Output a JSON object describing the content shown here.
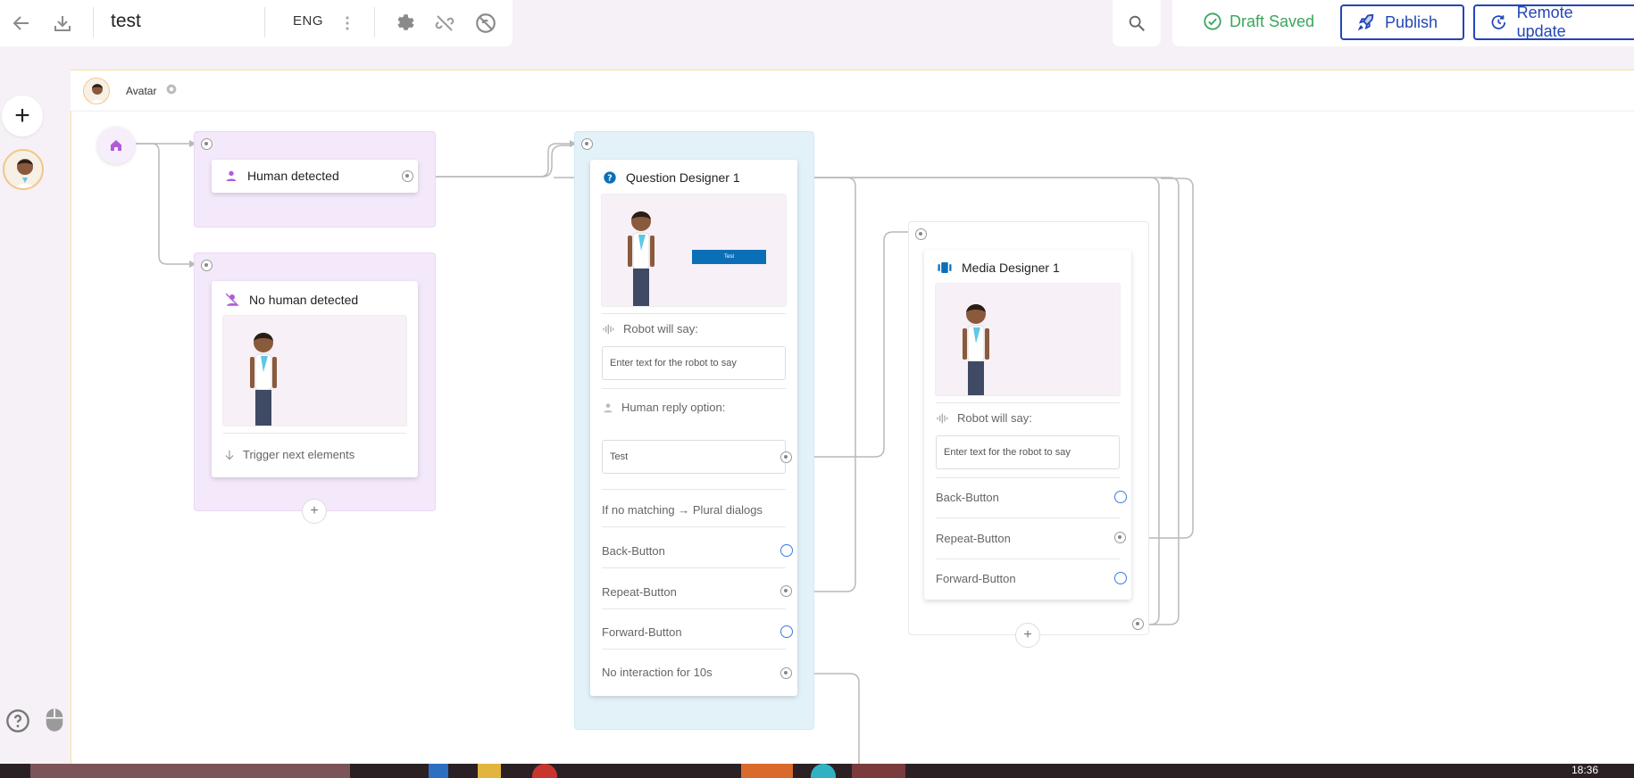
{
  "toolbar": {
    "title": "test",
    "language": "ENG",
    "draft_status": "Draft Saved",
    "publish_label": "Publish",
    "remote_update_label": "Remote update"
  },
  "canvas": {
    "avatar_label": "Avatar"
  },
  "nodes": {
    "human_detected": {
      "title": "Human detected"
    },
    "no_human_detected": {
      "title": "No human detected",
      "trigger": "Trigger next elements"
    },
    "question_designer": {
      "title": "Question Designer 1",
      "preview_button": "Test",
      "robot_will_say": "Robot will say:",
      "robot_placeholder": "Enter text for the robot to say",
      "human_reply": "Human reply option:",
      "reply_value": "Test",
      "no_match": "If no matching → Plural dialogs",
      "back": "Back-Button",
      "repeat": "Repeat-Button",
      "forward": "Forward-Button",
      "no_interaction": "No interaction for 10s"
    },
    "media_designer": {
      "title": "Media Designer 1",
      "robot_will_say": "Robot will say:",
      "robot_placeholder": "Enter text for the robot to say",
      "back": "Back-Button",
      "repeat": "Repeat-Button",
      "forward": "Forward-Button"
    }
  },
  "taskbar": {
    "clock": "18:36"
  },
  "colors": {
    "accent": "#2246b8",
    "success": "#3aa55c",
    "purple_group": "#f4e9fb",
    "blue_group": "#e3f2f9",
    "node_icon_purple": "#b15cd6",
    "node_icon_blue": "#0b6fb8"
  }
}
